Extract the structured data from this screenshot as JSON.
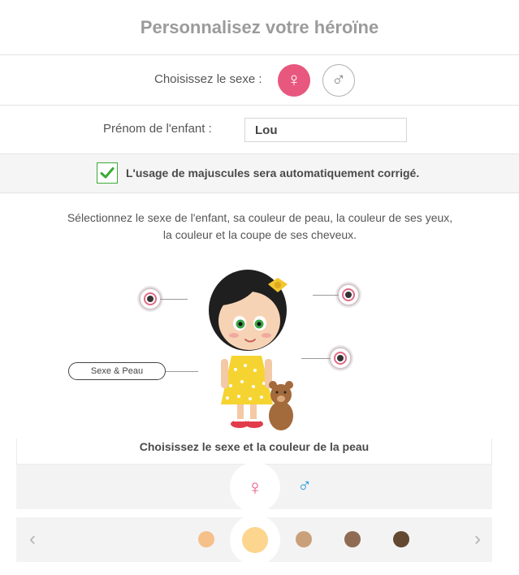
{
  "header": {
    "title": "Personnalisez votre héroïne"
  },
  "gender": {
    "label": "Choisissez le sexe :",
    "female_icon": "♀",
    "male_icon": "♂",
    "selected": "female"
  },
  "child_name": {
    "label": "Prénom de l'enfant :",
    "value": "Lou"
  },
  "notice": {
    "checked": true,
    "text": "L'usage de majuscules sera automatiquement corrigé."
  },
  "instructions": "Sélectionnez le sexe de l'enfant, sa couleur de peau, la couleur de ses yeux, la couleur et la coupe de ses cheveux.",
  "stage": {
    "pill_label": "Sexe & Peau"
  },
  "panel": {
    "title": "Choisissez le sexe et la couleur de la peau",
    "sex_options": [
      {
        "icon": "♀",
        "color": "#e8577e",
        "selected": true
      },
      {
        "icon": "♂",
        "color": "#1e98d9",
        "selected": false
      }
    ],
    "skin_tones": [
      {
        "color": "#f5c08a",
        "selected": false
      },
      {
        "color": "#fcd68e",
        "selected": true
      },
      {
        "color": "#c9a07a",
        "selected": false
      },
      {
        "color": "#8e6b52",
        "selected": false
      },
      {
        "color": "#634832",
        "selected": false
      }
    ],
    "prev_icon": "‹",
    "next_icon": "›"
  },
  "colors": {
    "accent_female": "#e8577e",
    "accent_male": "#1e98d9",
    "check_green": "#3aaa35"
  }
}
